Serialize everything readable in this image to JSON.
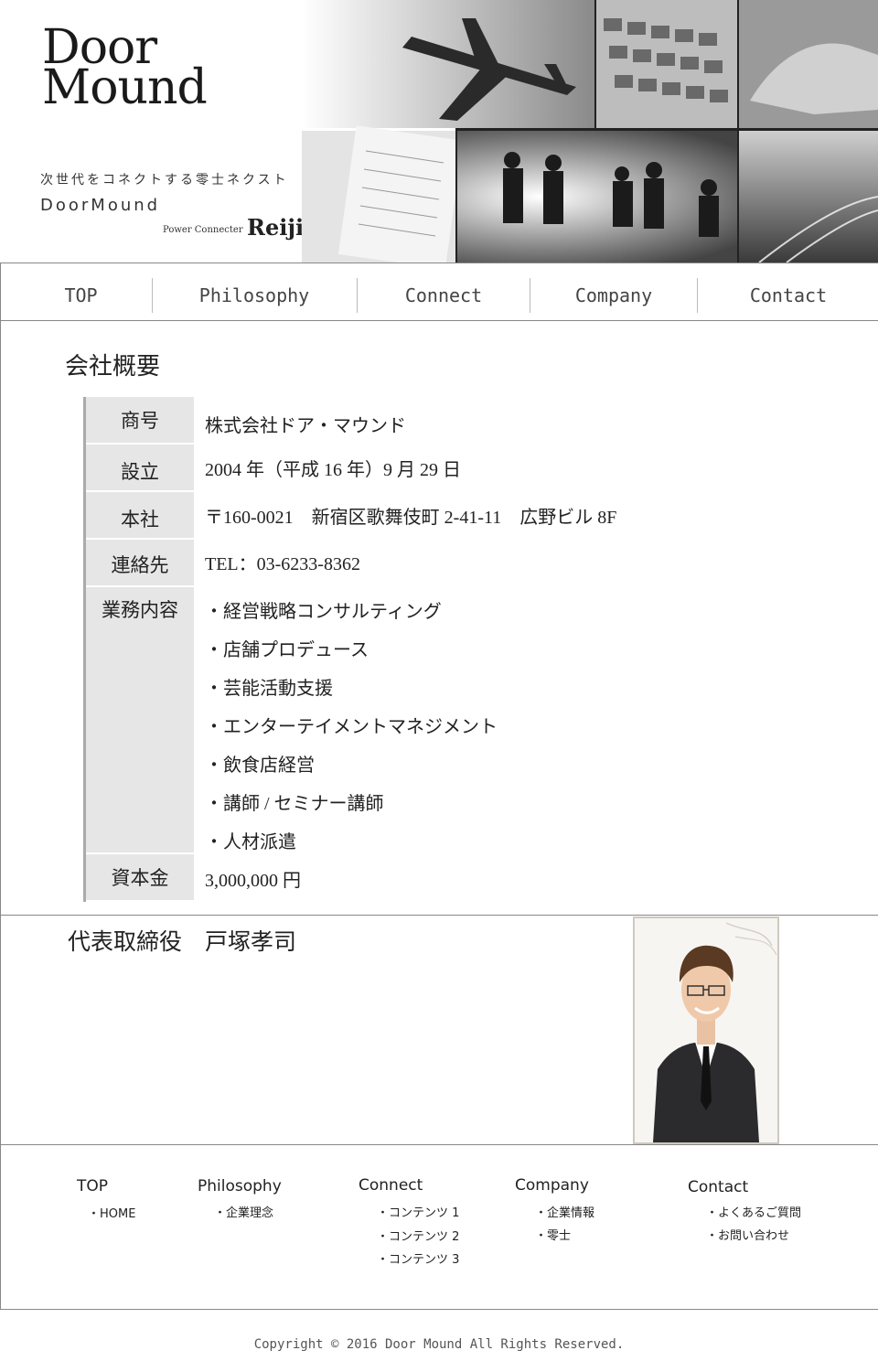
{
  "header": {
    "logo_line1": "Door",
    "logo_line2": "Mound",
    "tagline": "次世代をコネクトする零士ネクスト",
    "brand": "DoorMound",
    "power_connecter": "Power Connecter",
    "reiji": "Reiji"
  },
  "nav": {
    "items": [
      {
        "label": "TOP"
      },
      {
        "label": "Philosophy"
      },
      {
        "label": "Connect"
      },
      {
        "label": "Company"
      },
      {
        "label": "Contact"
      }
    ]
  },
  "company": {
    "title": "会社概要",
    "rows": [
      {
        "label": "商号",
        "value": "株式会社ドア・マウンド"
      },
      {
        "label": "設立",
        "value": "2004 年（平成 16 年）9 月 29 日"
      },
      {
        "label": "本社",
        "value": "〒160-0021　新宿区歌舞伎町 2-41-11　広野ビル 8F"
      },
      {
        "label": "連絡先",
        "value": "TEL：03-6233-8362"
      }
    ],
    "services_label": "業務内容",
    "services": [
      "・経営戦略コンサルティング",
      "・店舗プロデュース",
      "・芸能活動支援",
      "・エンターテイメントマネジメント",
      "・飲食店経営",
      "・講師 / セミナー講師",
      "・人材派遣"
    ],
    "capital_label": "資本金",
    "capital_value": "3,000,000 円"
  },
  "ceo": {
    "title": "代表取締役　戸塚孝司"
  },
  "footer": {
    "columns": [
      {
        "title": "TOP",
        "links": [
          "・HOME"
        ]
      },
      {
        "title": "Philosophy",
        "links": [
          "・企業理念"
        ]
      },
      {
        "title": "Connect",
        "links": [
          "・コンテンツ 1",
          "・コンテンツ 2",
          "・コンテンツ 3"
        ]
      },
      {
        "title": "Company",
        "links": [
          "・企業情報",
          "・零士"
        ]
      },
      {
        "title": "Contact",
        "links": [
          "・よくあるご質問",
          "・お問い合わせ"
        ]
      }
    ],
    "copyright": "Copyright © 2016 Door Mound All Rights Reserved."
  }
}
